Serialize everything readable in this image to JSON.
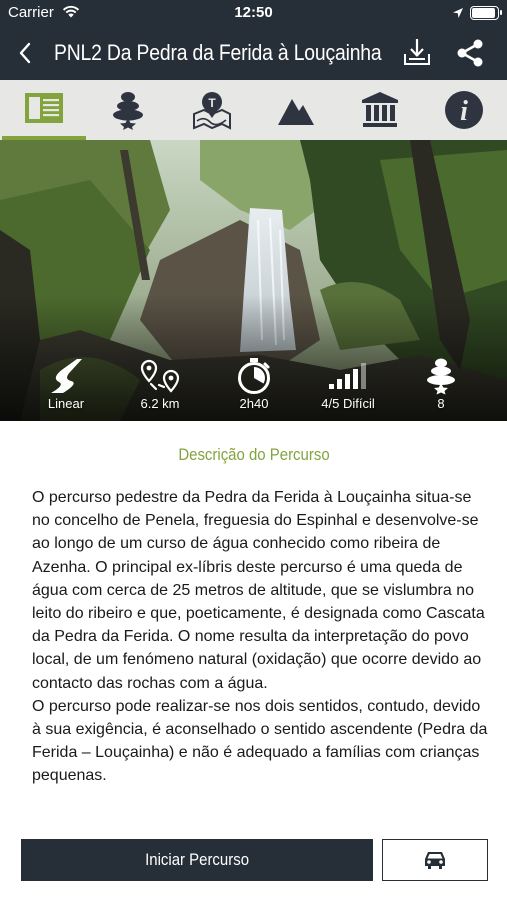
{
  "status_bar": {
    "carrier": "Carrier",
    "time": "12:50"
  },
  "nav": {
    "title": "PNL2 Da Pedra da Ferida à Louçainha"
  },
  "tabs": [
    {
      "icon": "description-icon",
      "active": true
    },
    {
      "icon": "stacked-stones-icon",
      "active": false
    },
    {
      "icon": "map-icon",
      "active": false
    },
    {
      "icon": "mountain-icon",
      "active": false
    },
    {
      "icon": "museum-icon",
      "active": false
    },
    {
      "icon": "info-icon",
      "active": false
    }
  ],
  "stats": [
    {
      "icon": "route-type-icon",
      "label": "Linear"
    },
    {
      "icon": "distance-icon",
      "label": "6.2 km"
    },
    {
      "icon": "stopwatch-icon",
      "label": "2h40"
    },
    {
      "icon": "difficulty-bars-icon",
      "label": "4/5 Difícil"
    },
    {
      "icon": "stacked-stones-icon",
      "label": "8"
    }
  ],
  "description": {
    "title": "Descrição do Percurso",
    "text": "O percurso pedestre da Pedra da Ferida à Louçainha situa-se no concelho de Penela, freguesia do Espinhal e desenvolve-se ao longo de um curso de água conhecido como ribeira de Azenha. O principal ex-líbris deste percurso é uma queda de água com cerca de 25 metros de altitude, que se vislumbra no leito do ribeiro e que, poeticamente, é designada como Cascata da Pedra da Ferida. O nome resulta da interpretação do povo local, de um fenómeno natural (oxidação) que ocorre devido ao contacto das rochas com a água.\nO percurso pode realizar-se nos dois sentidos, contudo, devido à sua exigência, é aconselhado o sentido ascendente (Pedra da Ferida – Louçainha) e não é adequado a famílias com crianças pequenas."
  },
  "buttons": {
    "start": "Iniciar Percurso",
    "car_icon": "car-icon"
  },
  "colors": {
    "dark": "#262e37",
    "accent": "#83a43c",
    "tab_bg": "#e7e7e5",
    "tab_icon": "#2f3540"
  }
}
